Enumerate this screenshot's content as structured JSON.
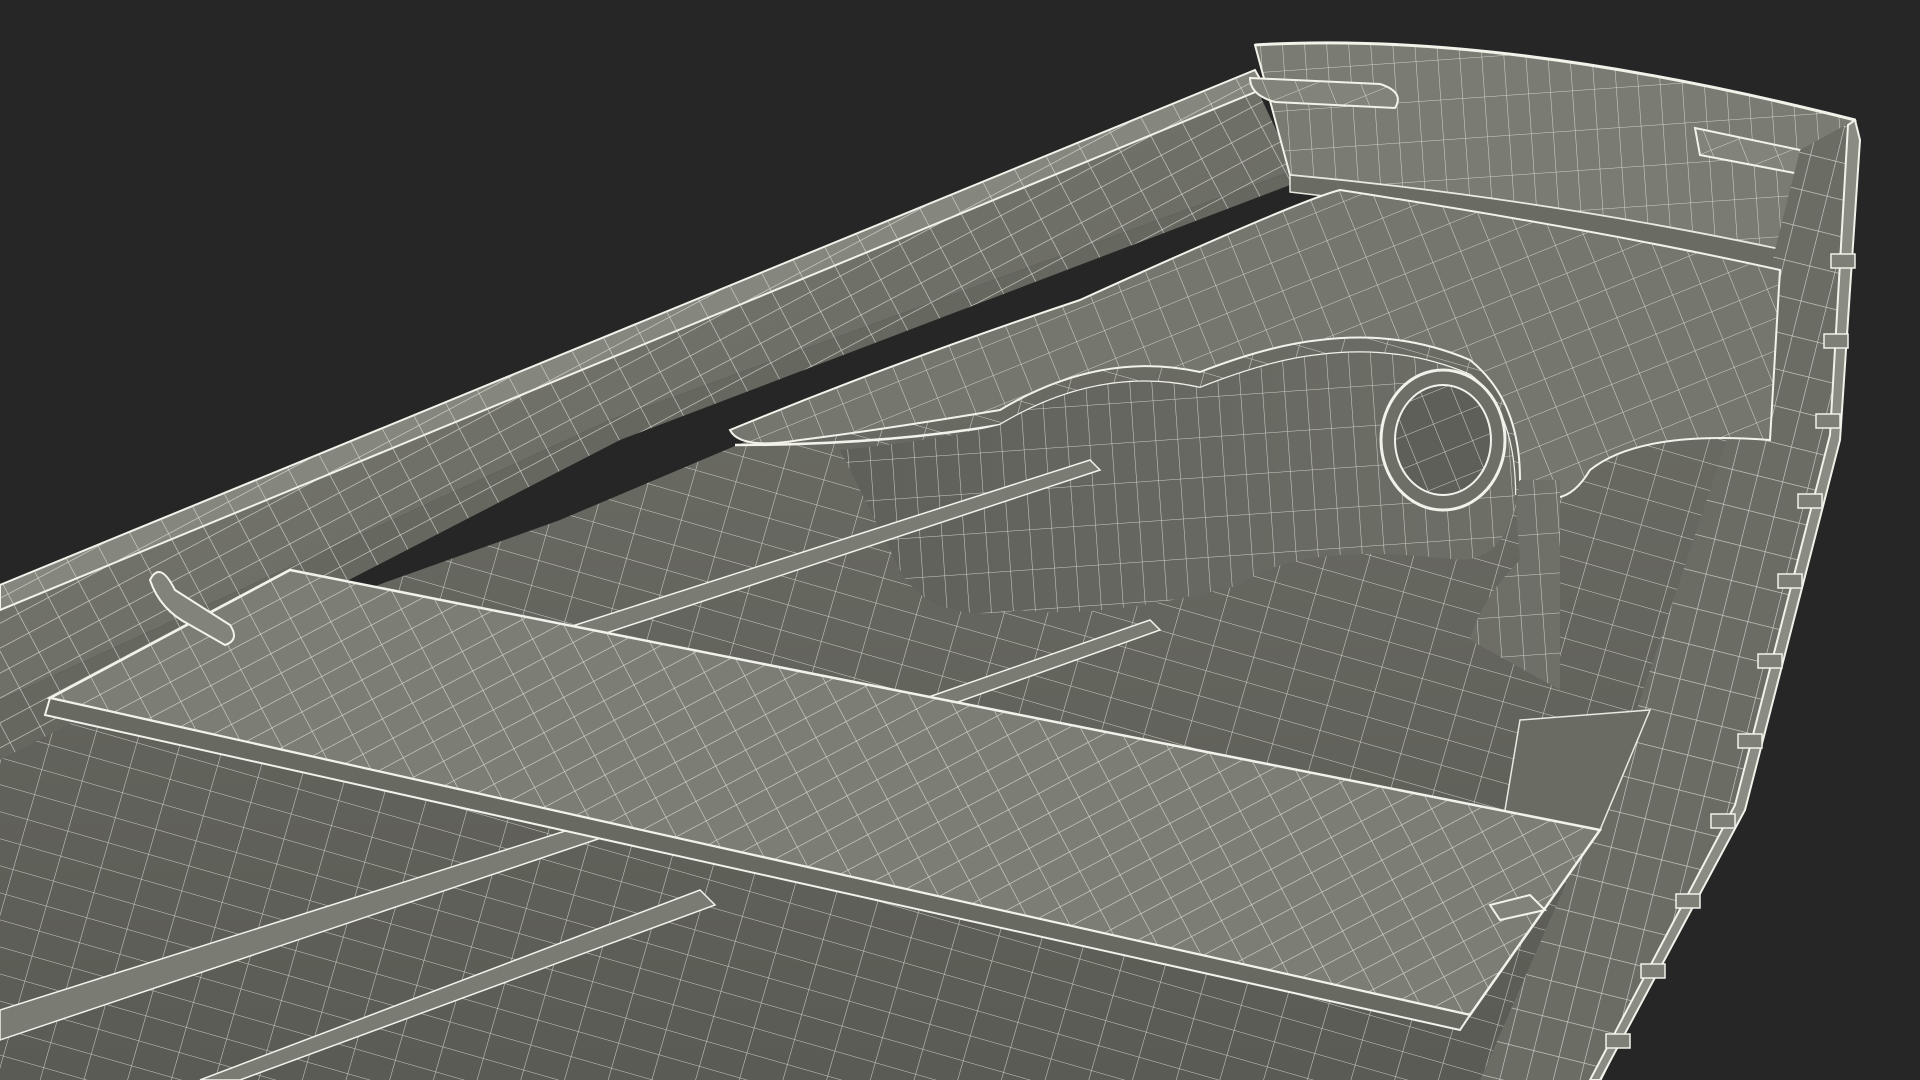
{
  "scene": {
    "subject": "rowboat-interior-wireframe",
    "background_color": "#262626",
    "surface_color": "#6e6f66",
    "surface_dark_color": "#55564f",
    "surface_light_color": "#7c7d74",
    "wire_color": "#e8e8e0",
    "edge_color": "#f2f2ea"
  }
}
